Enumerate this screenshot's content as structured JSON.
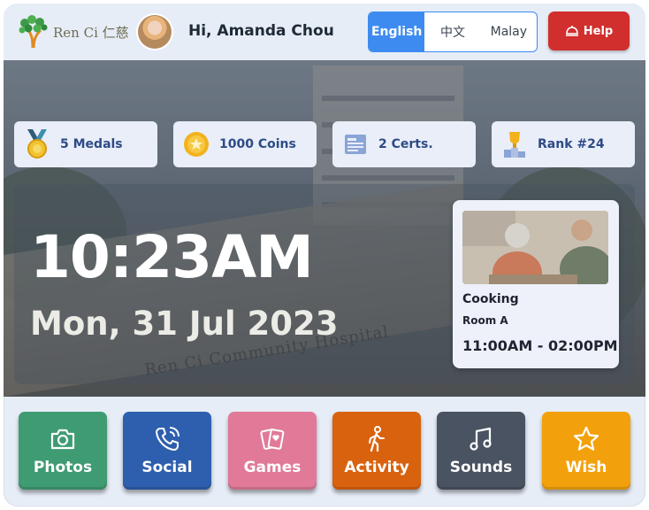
{
  "header": {
    "logo_text": "Ren Ci 仁慈",
    "greeting": "Hi, Amanda Chou",
    "languages": [
      {
        "label": "English",
        "active": true
      },
      {
        "label": "中文",
        "active": false
      },
      {
        "label": "Malay",
        "active": false
      }
    ],
    "help_label": "Help"
  },
  "stats": [
    {
      "label": "5 Medals",
      "icon": "medal-icon"
    },
    {
      "label": "1000 Coins",
      "icon": "coin-icon"
    },
    {
      "label": "2 Certs.",
      "icon": "certificate-icon"
    },
    {
      "label": "Rank #24",
      "icon": "trophy-icon"
    }
  ],
  "clock": {
    "time": "10:23AM",
    "date": "Mon, 31 Jul 2023"
  },
  "hero": {
    "background_sign": "Ren Ci Community Hospital"
  },
  "event": {
    "title": "Cooking",
    "room": "Room A",
    "time": "11:00AM - 02:00PM"
  },
  "nav": [
    {
      "label": "Photos",
      "icon": "camera-icon",
      "color": "#3f9b72"
    },
    {
      "label": "Social",
      "icon": "phone-icon",
      "color": "#2e5fae"
    },
    {
      "label": "Games",
      "icon": "cards-icon",
      "color": "#e07a98"
    },
    {
      "label": "Activity",
      "icon": "walking-person-icon",
      "color": "#d9620f"
    },
    {
      "label": "Sounds",
      "icon": "music-note-icon",
      "color": "#4a5361"
    },
    {
      "label": "Wish",
      "icon": "star-icon",
      "color": "#f2a10c"
    }
  ]
}
